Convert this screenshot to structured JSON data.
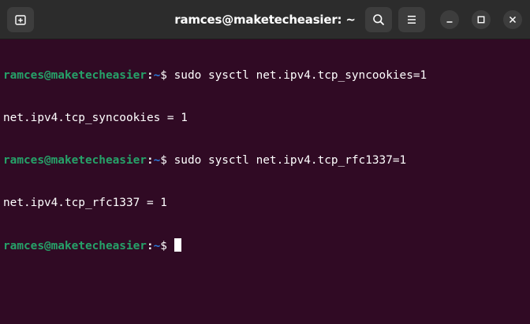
{
  "window": {
    "title": "ramces@maketecheasier: ~"
  },
  "titlebar": {
    "buttons": [
      {
        "name": "new-tab",
        "icon": "new-tab-icon"
      },
      {
        "name": "search",
        "icon": "search-icon"
      },
      {
        "name": "menu",
        "icon": "hamburger-menu-icon"
      },
      {
        "name": "minimize",
        "icon": "minimize-icon"
      },
      {
        "name": "maximize",
        "icon": "maximize-icon"
      },
      {
        "name": "close",
        "icon": "close-icon"
      }
    ]
  },
  "terminal": {
    "colors": {
      "background": "#300a24",
      "user": "#26a269",
      "path": "#2a7bde",
      "text": "#ffffff"
    },
    "prompt": {
      "user_host": "ramces@maketecheasier",
      "separator": ":",
      "path": "~",
      "symbol": "$ "
    },
    "lines": [
      {
        "type": "command",
        "command": "sudo sysctl net.ipv4.tcp_syncookies=1"
      },
      {
        "type": "output",
        "text": "net.ipv4.tcp_syncookies = 1"
      },
      {
        "type": "command",
        "command": "sudo sysctl net.ipv4.tcp_rfc1337=1"
      },
      {
        "type": "output",
        "text": "net.ipv4.tcp_rfc1337 = 1"
      },
      {
        "type": "command",
        "command": ""
      }
    ]
  }
}
